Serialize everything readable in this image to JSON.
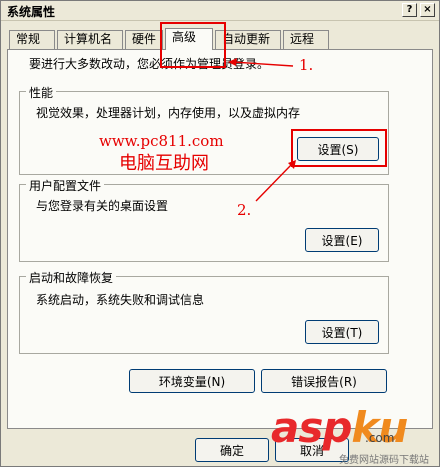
{
  "window": {
    "title": "系统属性",
    "help_label": "?",
    "close_label": "×"
  },
  "tabs": [
    {
      "label": "常规"
    },
    {
      "label": "计算机名"
    },
    {
      "label": "硬件"
    },
    {
      "label": "高级",
      "active": true
    },
    {
      "label": "自动更新"
    },
    {
      "label": "远程"
    }
  ],
  "note": "要进行大多数改动，您必须作为管理员登录。",
  "groups": {
    "performance": {
      "title": "性能",
      "desc": "视觉效果，处理器计划，内存使用，以及虚拟内存",
      "button": "设置(S)"
    },
    "profiles": {
      "title": "用户配置文件",
      "desc": "与您登录有关的桌面设置",
      "button": "设置(E)"
    },
    "startup": {
      "title": "启动和故障恢复",
      "desc": "系统启动，系统失败和调试信息",
      "button": "设置(T)"
    }
  },
  "env_button": "环境变量(N)",
  "error_button": "错误报告(R)",
  "ok_button": "确定",
  "cancel_button": "取消",
  "annotations": {
    "step1": "1.",
    "step2": "2."
  },
  "watermark": {
    "url": "www.pc811.com",
    "name": "电脑互助网"
  },
  "logo": {
    "brand": "asp",
    "brand_suffix": "ku",
    "tagline": ".com",
    "sub": "免费网站源码下载站"
  },
  "colors": {
    "highlight": "#e60000",
    "window": "#ece9d8",
    "panel": "#fbfbf7"
  }
}
